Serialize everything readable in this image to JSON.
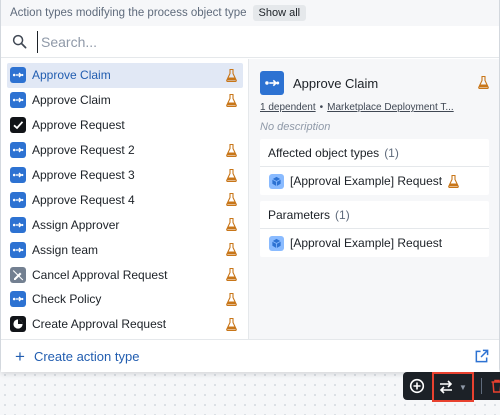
{
  "header": {
    "label": "Action types modifying the process object type",
    "show_all": "Show all"
  },
  "search": {
    "placeholder": "Search..."
  },
  "list": {
    "items": [
      {
        "label": "Approve Claim",
        "icon": "action-icon",
        "icon_color": "blue",
        "selected": true
      },
      {
        "label": "Approve Claim",
        "icon": "action-icon",
        "icon_color": "blue"
      },
      {
        "label": "Approve Request",
        "icon": "check-icon",
        "icon_color": "black"
      },
      {
        "label": "Approve Request 2",
        "icon": "action-icon",
        "icon_color": "blue"
      },
      {
        "label": "Approve Request 3",
        "icon": "action-icon",
        "icon_color": "blue"
      },
      {
        "label": "Approve Request 4",
        "icon": "action-icon",
        "icon_color": "blue"
      },
      {
        "label": "Assign Approver",
        "icon": "action-icon",
        "icon_color": "blue"
      },
      {
        "label": "Assign team",
        "icon": "action-icon",
        "icon_color": "blue"
      },
      {
        "label": "Cancel Approval Request",
        "icon": "edit-off-icon",
        "icon_color": "gray"
      },
      {
        "label": "Check Policy",
        "icon": "action-icon",
        "icon_color": "blue"
      },
      {
        "label": "Create Approval Request",
        "icon": "pie-icon",
        "icon_color": "black"
      }
    ]
  },
  "detail": {
    "title": "Approve Claim",
    "dependents": "1 dependent",
    "dot": "•",
    "deployment": "Marketplace Deployment T...",
    "description": "No description",
    "affected": {
      "title": "Affected object types",
      "count": "(1)",
      "item": "[Approval Example] Request"
    },
    "parameters": {
      "title": "Parameters",
      "count": "(1)",
      "item": "[Approval Example] Request"
    }
  },
  "footer": {
    "create_label": "Create action type",
    "plus": "+"
  },
  "colors": {
    "accent": "#2d72d2",
    "link": "#215db0",
    "experimental": "#c87619",
    "highlight_border": "#e8412f"
  }
}
